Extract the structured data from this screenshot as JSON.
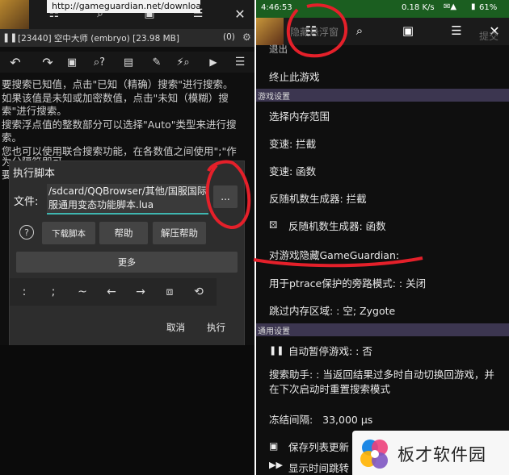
{
  "left": {
    "url": "http://gameguardian.net/download",
    "process_bar": "[23440] 空中大师 (embryo) [23.98 MB]",
    "process_count": "(0)",
    "help_lines": [
      "要搜索已知值，点击\"已知（精确）搜索\"进行搜索。",
      "如果该值是未知或加密数值，点击\"未知（模糊）搜",
      "索\"进行搜索。",
      "搜索浮点值的整数部分可以选择\"Auto\"类型来进行搜",
      "索。",
      "您也可以使用联合搜索功能，在各数值之间使用\";\"作",
      "为分隔符即可。",
      "要"
    ],
    "dialog": {
      "title": "执行脚本",
      "file_label": "文件:",
      "file_path": "/sdcard/QQBrowser/其他/国服国际服通用变态功能脚本.lua",
      "browse_label": "...",
      "help_icon": "question-circle-icon",
      "download_label": "下载脚本",
      "help_label": "帮助",
      "decompress_help_label": "解压帮助",
      "more_label": "更多",
      "keys": [
        ":",
        ";",
        "~",
        "←",
        "→",
        "⧈",
        "⟲"
      ],
      "cancel_label": "取消",
      "execute_label": "执行"
    }
  },
  "right": {
    "status": {
      "time": "4:46:53",
      "speed": "0.18 K/s",
      "battery": "61%"
    },
    "toolbar_tab": "隐藏悬浮窗",
    "toolbar_right": "提交",
    "items": {
      "back": "退出",
      "stop": "终止此游戏",
      "memory_range": "选择内存范围",
      "speed_intercept": "变速: 拦截",
      "speed_func": "变速: 函数",
      "anti_rng_intercept": "反随机数生成器: 拦截",
      "anti_rng_func": "反随机数生成器: 函数",
      "hide_gg": "对游戏隐藏GameGuardian:",
      "ptrace": "用于ptrace保护的旁路模式: : 关闭",
      "skip_memory": "跳过内存区域: : 空; Zygote",
      "auto_pause": "自动暂停游戏: : 否",
      "search_helper": "搜索助手: : 当返回结果过多时自动切换回游戏，并在下次启动时重置搜索模式",
      "freeze_interval": "冻结间隔:   33,000 µs",
      "save_list": "保存列表更新",
      "show_time": "显示时间跳转"
    },
    "sections": {
      "game_settings": "游戏设置",
      "general_settings": "通用设置"
    }
  },
  "watermark": {
    "text": "板才软件园"
  },
  "colors": {
    "status_green": "#1b5e20",
    "section_purple": "#3c3650",
    "annotation_red": "#e4202a",
    "path_teal": "#3fb6b0"
  }
}
